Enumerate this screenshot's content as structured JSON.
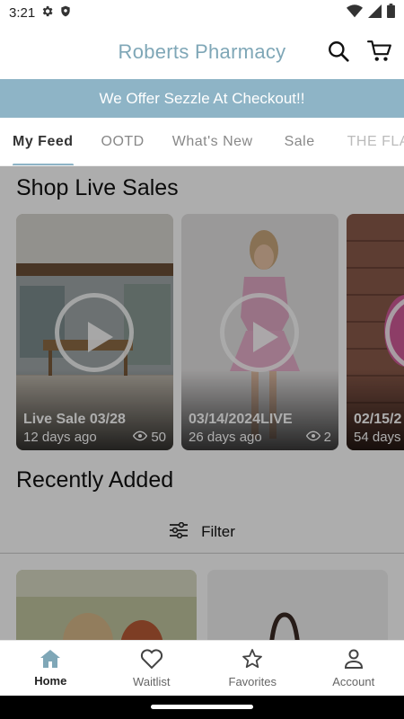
{
  "status_bar": {
    "time": "3:21"
  },
  "header": {
    "title": "Roberts Pharmacy"
  },
  "promo": {
    "text": "We Offer Sezzle At Checkout!!"
  },
  "tabs": [
    {
      "label": "My Feed"
    },
    {
      "label": "OOTD"
    },
    {
      "label": "What's New"
    },
    {
      "label": "Sale"
    },
    {
      "label": "THE FLA"
    }
  ],
  "live_sales": {
    "title": "Shop Live Sales",
    "cards": [
      {
        "title": "Live Sale 03/28",
        "age": "12 days ago",
        "views": "50"
      },
      {
        "title": "03/14/2024LIVE",
        "age": "26 days ago",
        "views": "2"
      },
      {
        "title": "02/15/2",
        "age": "54 days",
        "views": ""
      }
    ]
  },
  "recently_added": {
    "title": "Recently Added",
    "filter_label": "Filter"
  },
  "bottom_nav": [
    {
      "label": "Home"
    },
    {
      "label": "Waitlist"
    },
    {
      "label": "Favorites"
    },
    {
      "label": "Account"
    }
  ],
  "colors": {
    "brand": "#7fa7b7",
    "banner": "#8eb4c6"
  }
}
